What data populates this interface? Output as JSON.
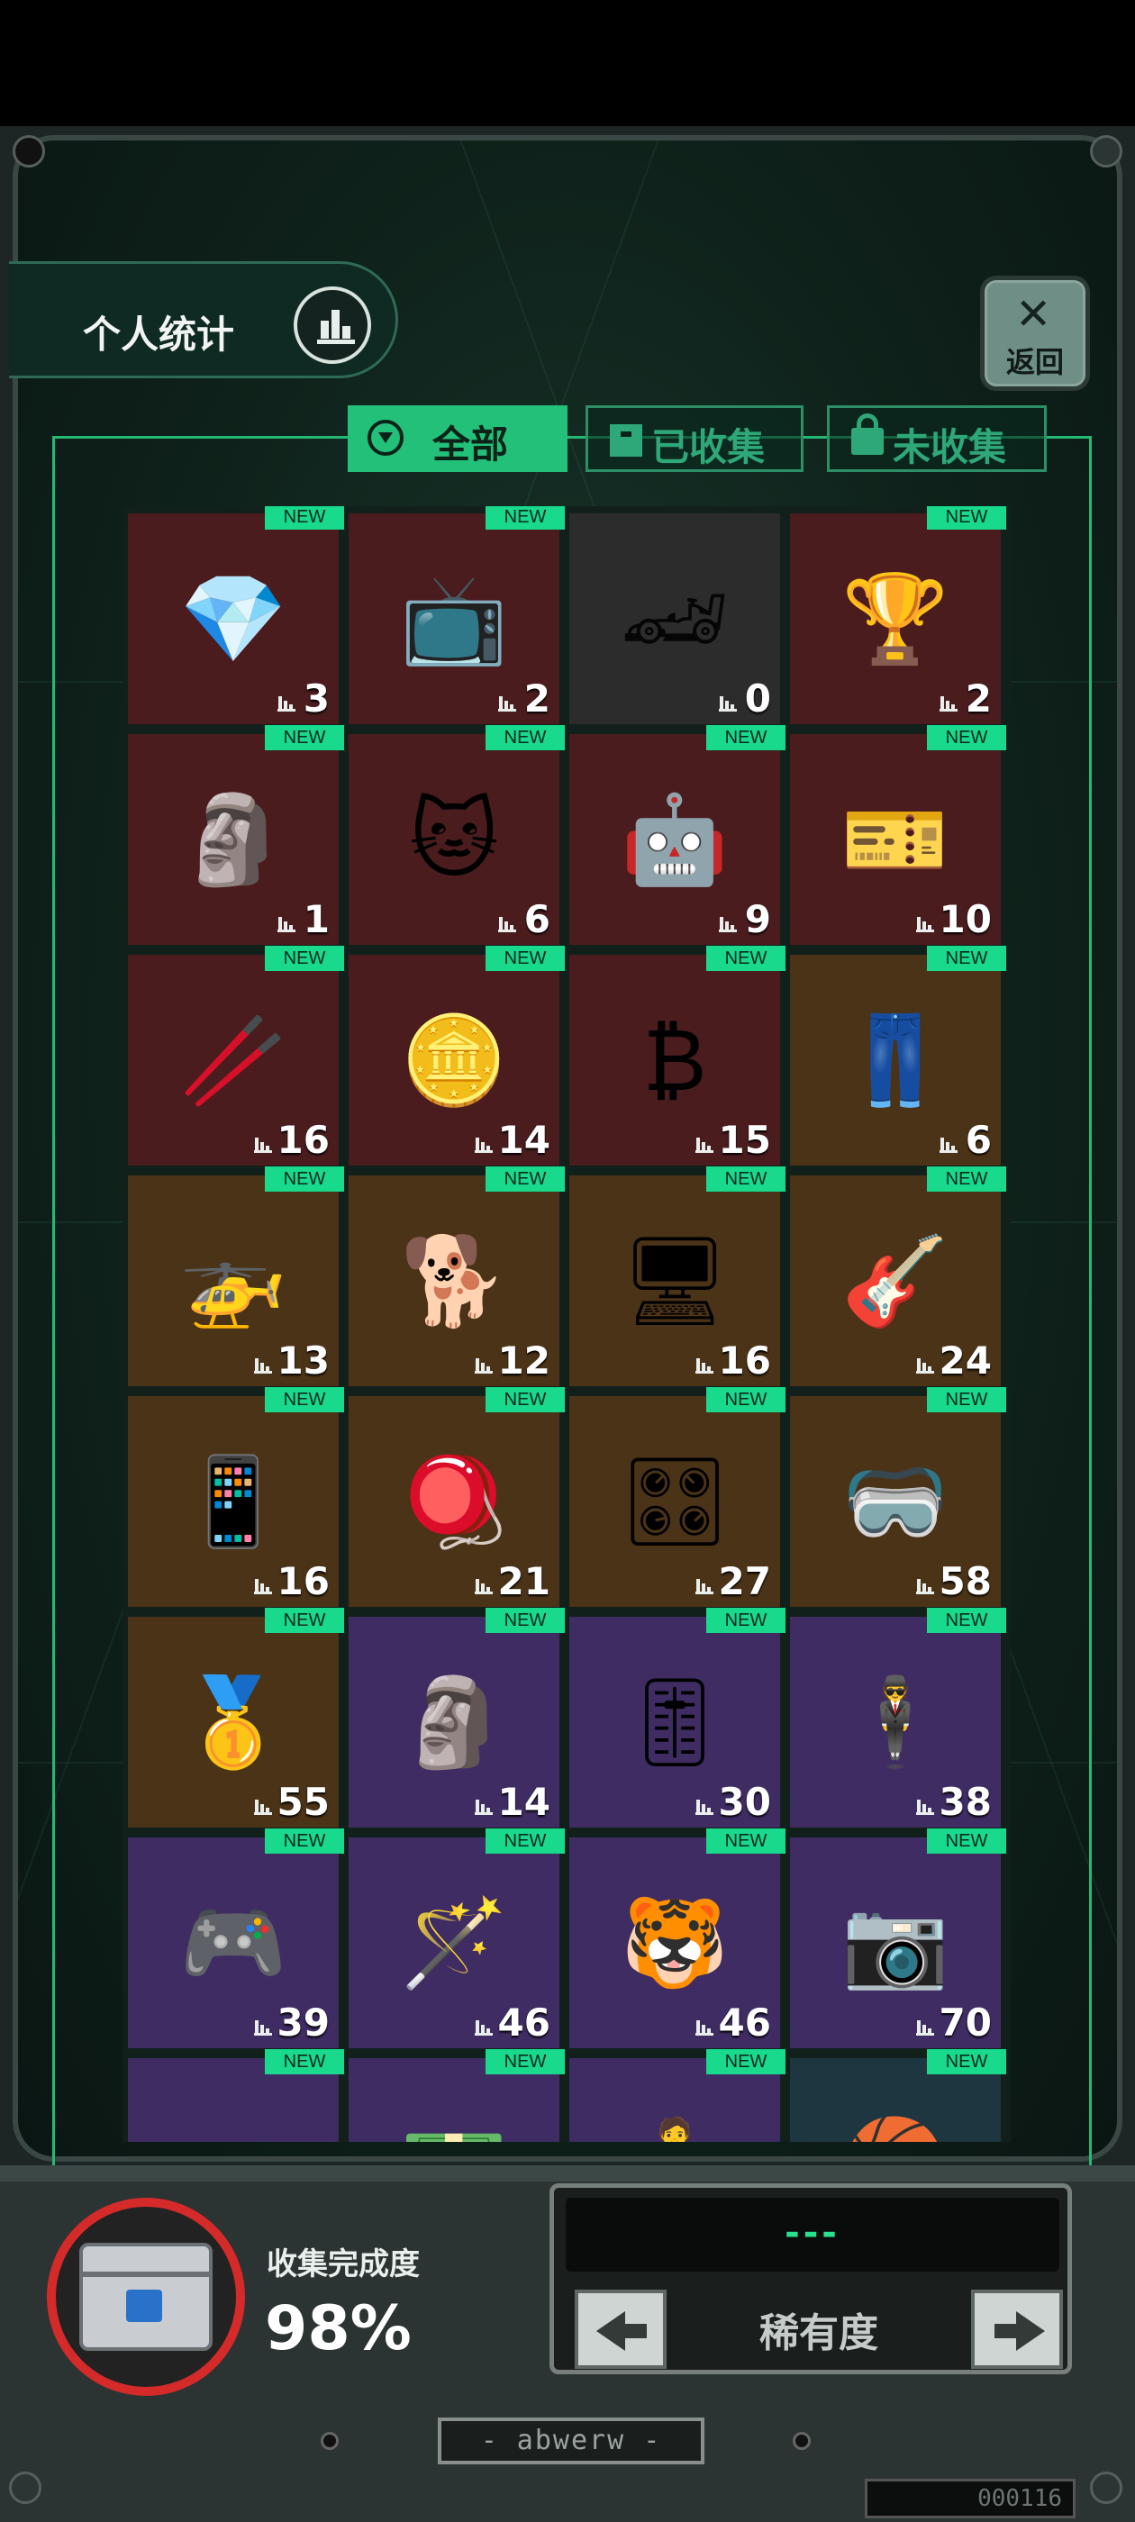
{
  "header": {
    "stats_label": "个人统计",
    "back_label": "返回"
  },
  "tabs": {
    "all": "全部",
    "collected": "已收集",
    "uncollected": "未收集"
  },
  "badge_text": "NEW",
  "items": [
    {
      "count": "3",
      "rarity": "red",
      "icon": "crystal-icon",
      "glyph": "💎",
      "new": true
    },
    {
      "count": "2",
      "rarity": "red",
      "icon": "retro-tv-icon",
      "glyph": "📺",
      "new": true
    },
    {
      "count": "0",
      "rarity": "gray",
      "icon": "car-silhouette-icon",
      "glyph": "🏎",
      "new": false,
      "locked": true
    },
    {
      "count": "2",
      "rarity": "red",
      "icon": "trophy-cup-icon",
      "glyph": "🏆",
      "new": true
    },
    {
      "count": "1",
      "rarity": "red",
      "icon": "statue-icon",
      "glyph": "🗿",
      "new": true
    },
    {
      "count": "6",
      "rarity": "red",
      "icon": "cat-character-icon",
      "glyph": "🐱",
      "new": true
    },
    {
      "count": "9",
      "rarity": "red",
      "icon": "robot-drone-icon",
      "glyph": "🤖",
      "new": true
    },
    {
      "count": "10",
      "rarity": "red",
      "icon": "ticket-card-icon",
      "glyph": "🎫",
      "new": true
    },
    {
      "count": "16",
      "rarity": "red",
      "icon": "chopsticks-icon",
      "glyph": "🥢",
      "new": true
    },
    {
      "count": "14",
      "rarity": "red",
      "icon": "silver-coin-icon",
      "glyph": "🪙",
      "new": true
    },
    {
      "count": "15",
      "rarity": "red",
      "icon": "bitcoin-icon",
      "glyph": "₿",
      "new": true
    },
    {
      "count": "6",
      "rarity": "brown",
      "icon": "overalls-icon",
      "glyph": "👖",
      "new": true
    },
    {
      "count": "13",
      "rarity": "brown",
      "icon": "quad-drone-icon",
      "glyph": "🚁",
      "new": true
    },
    {
      "count": "12",
      "rarity": "brown",
      "icon": "robot-dog-icon",
      "glyph": "🐕",
      "new": true
    },
    {
      "count": "16",
      "rarity": "brown",
      "icon": "folding-screen-icon",
      "glyph": "🖥",
      "new": true
    },
    {
      "count": "24",
      "rarity": "brown",
      "icon": "electric-guitar-icon",
      "glyph": "🎸",
      "new": true
    },
    {
      "count": "16",
      "rarity": "brown",
      "icon": "phone-icon",
      "glyph": "📱",
      "new": true
    },
    {
      "count": "21",
      "rarity": "brown",
      "icon": "spinning-top-icon",
      "glyph": "🪀",
      "new": true
    },
    {
      "count": "27",
      "rarity": "brown",
      "icon": "graphics-card-icon",
      "glyph": "🎛",
      "new": true
    },
    {
      "count": "58",
      "rarity": "brown",
      "icon": "vr-head-icon",
      "glyph": "🥽",
      "new": true
    },
    {
      "count": "55",
      "rarity": "brown",
      "icon": "gold-ingot-icon",
      "glyph": "🥇",
      "new": true
    },
    {
      "count": "14",
      "rarity": "purple",
      "icon": "terracotta-warrior-icon",
      "glyph": "🗿",
      "new": true
    },
    {
      "count": "30",
      "rarity": "purple",
      "icon": "turntable-icon",
      "glyph": "🎚",
      "new": true
    },
    {
      "count": "38",
      "rarity": "purple",
      "icon": "pallbearers-icon",
      "glyph": "🕴",
      "new": true
    },
    {
      "count": "39",
      "rarity": "purple",
      "icon": "bmo-console-icon",
      "glyph": "🎮",
      "new": true
    },
    {
      "count": "46",
      "rarity": "purple",
      "icon": "staff-icon",
      "glyph": "🪄",
      "new": true
    },
    {
      "count": "46",
      "rarity": "purple",
      "icon": "tiger-scroll-icon",
      "glyph": "🐯",
      "new": true
    },
    {
      "count": "70",
      "rarity": "purple",
      "icon": "camera-icon",
      "glyph": "📷",
      "new": true
    },
    {
      "count": "",
      "rarity": "purple",
      "icon": "dark-item-icon",
      "glyph": "🕶",
      "new": true
    },
    {
      "count": "",
      "rarity": "purple",
      "icon": "cash-stack-icon",
      "glyph": "💵",
      "new": true
    },
    {
      "count": "",
      "rarity": "purple",
      "icon": "figure-icon",
      "glyph": "🧍",
      "new": true
    },
    {
      "count": "",
      "rarity": "teal",
      "icon": "basketball-icon",
      "glyph": "🏀",
      "new": true
    }
  ],
  "progress": {
    "title": "收集完成度",
    "value": "98%",
    "fraction": 0.98
  },
  "rarity": {
    "screen_text": "---",
    "label": "稀有度"
  },
  "nameplate": "- abwerw -",
  "serial": "000116",
  "colors": {
    "accent": "#23c07a",
    "badge": "#18d98c",
    "rarity_red": "#4a1c1e",
    "rarity_brown": "#4b3317",
    "rarity_purple": "#3f2c63",
    "progress_ring": "#d42a2a"
  }
}
